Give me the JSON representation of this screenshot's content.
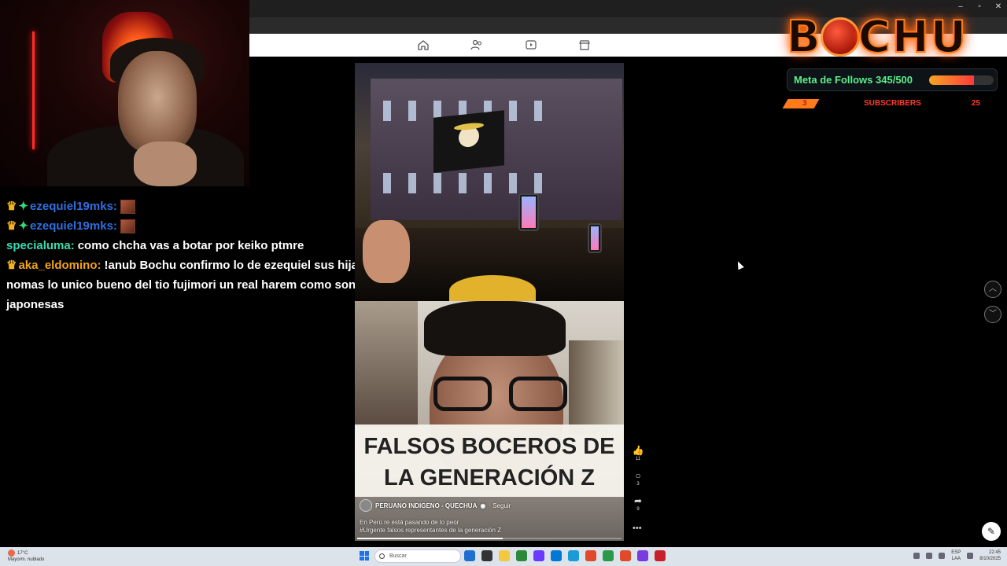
{
  "window_controls": [
    "–",
    "▫",
    "✕"
  ],
  "fb_nav": {
    "icons": [
      "home-icon",
      "friends-icon",
      "watch-icon",
      "marketplace-icon"
    ]
  },
  "chat": [
    {
      "badges": [
        "crown",
        "star"
      ],
      "user": "ezequiel19mks:",
      "user_color": "#2f6fe0",
      "text": "",
      "emote": true
    },
    {
      "badges": [
        "crown",
        "star"
      ],
      "user": "ezequiel19mks:",
      "user_color": "#2f6fe0",
      "text": "",
      "emote": true
    },
    {
      "badges": [],
      "user": "specialuma:",
      "user_color": "#3ddbb0",
      "text": "como chcha vas a botar por keiko ptmre",
      "emote": false
    },
    {
      "badges": [
        "crown"
      ],
      "user": "aka_eldomino:",
      "user_color": "#f2a51a",
      "text": "!anub Bochu confirmo lo de ezequiel sus hijas nomas lo unico bueno del tio fujimori un real harem como son japonesas",
      "emote": false
    }
  ],
  "video": {
    "caption_line1": "FALSOS BOCEROS DE",
    "caption_line2": "LA GENERACIÓN Z",
    "author": "PERUANO INDIGENO - QUECHUA",
    "follow_label": "· Seguir",
    "desc_line1": "En Perú re está pasando de lo peor",
    "desc_line2": "#Urgente falsos representantes de la generación Z",
    "progress": 0.55
  },
  "reactions": [
    {
      "icon": "like-icon",
      "glyph": "👍",
      "count": "11"
    },
    {
      "icon": "comment-icon",
      "glyph": "○",
      "count": "3"
    },
    {
      "icon": "share-icon",
      "glyph": "➦",
      "count": "9"
    }
  ],
  "overlay": {
    "logo_left": "B",
    "logo_right": "CHU",
    "follows_label": "Meta de Follows 345/500",
    "follows_progress": 0.69,
    "subs_count": "3",
    "subs_label": "SUBSCRIBERS",
    "subs_total": "25"
  },
  "taskbar": {
    "weather_temp": "17°C",
    "weather_desc": "Mayorm. nublado",
    "search_placeholder": "Buscar",
    "lang_line1": "ESP",
    "lang_line2": "LAA",
    "time": "22:45",
    "date": "8/10/2025",
    "app_colors": [
      "#1e6fd0",
      "#333",
      "#f5c842",
      "#2a8a3a",
      "#6a3aff",
      "#0078d4",
      "#1a9ad6",
      "#e04a2a",
      "#2a9a4a",
      "#e04a2a",
      "#7a3ae0",
      "#c8202a"
    ]
  },
  "colors": {
    "accent_orange": "#ff7a1a",
    "follow_green": "#5cf08a",
    "subs_red": "#ff3a2a"
  }
}
